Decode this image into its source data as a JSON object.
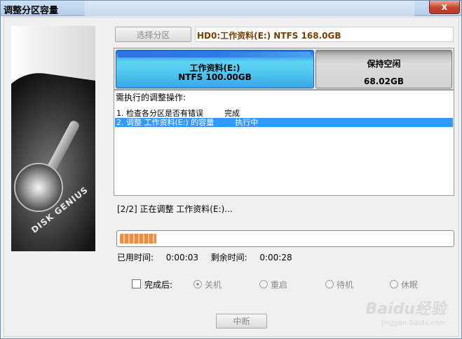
{
  "window": {
    "title": "调整分区容量",
    "close_label": "x"
  },
  "branding": {
    "image_text": "DISK GENIUS"
  },
  "select_button": "选择分区",
  "disk_info": "HD0:工作资料(E:) NTFS 168.0GB",
  "partitions": [
    {
      "name": "工作资料(E:)",
      "size": "NTFS 100.00GB"
    },
    {
      "name": "保持空闲",
      "size": "68.02GB"
    }
  ],
  "operations": {
    "title": "需执行的调整操作:",
    "items": [
      {
        "label": "1. 检查各分区是否有错误",
        "status": "完成"
      },
      {
        "label": "2. 调整 工作资料(E:) 的容量",
        "status": "执行中"
      }
    ]
  },
  "status_text": "[2/2] 正在调整 工作资料(E:)...",
  "progress": {
    "fraction": 0.11
  },
  "time": {
    "elapsed_label": "已用时间:",
    "elapsed_value": "0:00:03",
    "remaining_label": "剩余时间:",
    "remaining_value": "0:00:28"
  },
  "after_complete": {
    "label": "完成后:",
    "checked": false,
    "options": [
      "关机",
      "重启",
      "待机",
      "休眠"
    ],
    "selected": "关机"
  },
  "abort_button": "中断",
  "watermark": {
    "text": "Baidu经验",
    "sub": "jingyan.baidu.com"
  },
  "colors": {
    "partition_used": "#4fc7ee",
    "partition_free": "#d2d2d2",
    "selection": "#3399ff",
    "progress": "#f08a3c"
  }
}
